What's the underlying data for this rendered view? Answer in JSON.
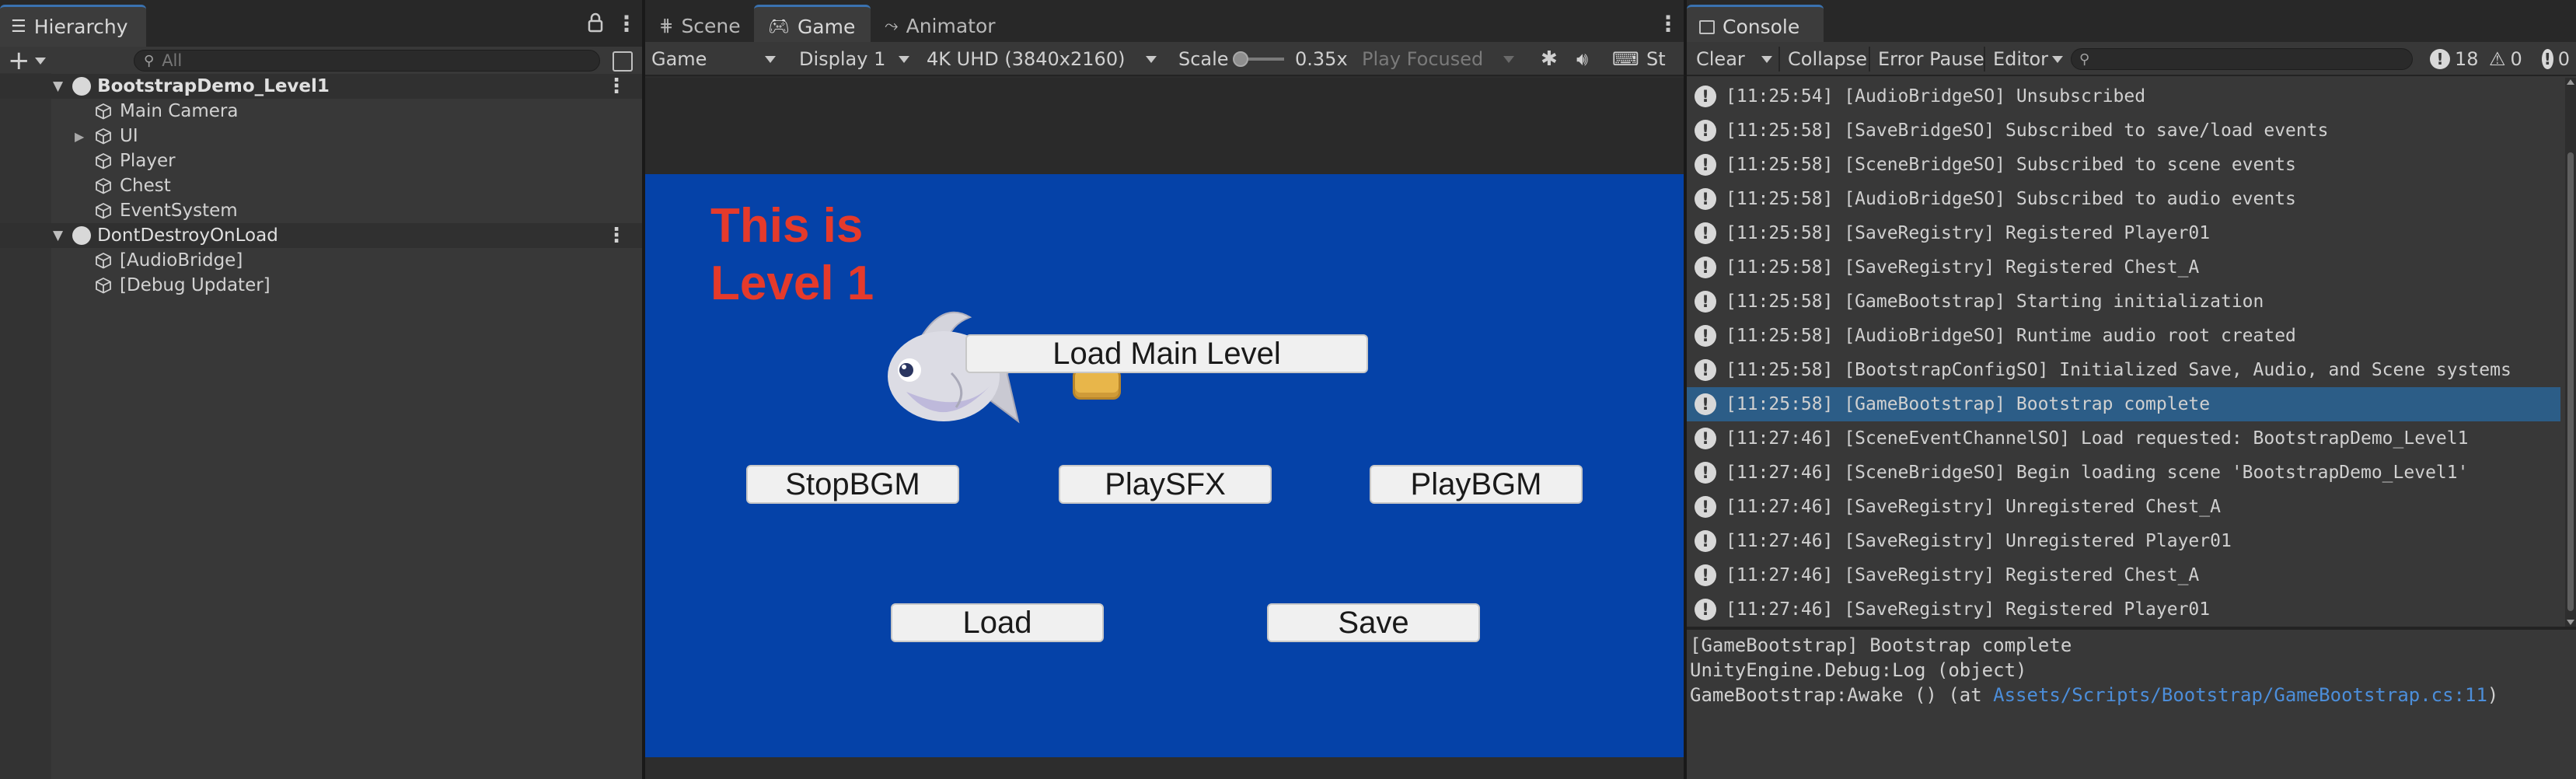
{
  "hierarchy": {
    "tab_label": "Hierarchy",
    "search_placeholder": "All",
    "items": [
      {
        "label": "BootstrapDemo_Level1"
      },
      {
        "label": "Main Camera"
      },
      {
        "label": "UI"
      },
      {
        "label": "Player"
      },
      {
        "label": "Chest"
      },
      {
        "label": "EventSystem"
      },
      {
        "label": "DontDestroyOnLoad"
      },
      {
        "label": "[AudioBridge]"
      },
      {
        "label": "[Debug Updater]"
      }
    ]
  },
  "center": {
    "tabs": [
      {
        "label": "Scene"
      },
      {
        "label": "Game"
      },
      {
        "label": "Animator"
      }
    ],
    "toolbar": {
      "view_mode": "Game",
      "display": "Display 1",
      "resolution": "4K UHD (3840x2160)",
      "scale_label": "Scale",
      "scale_value": "0.35x",
      "play_mode": "Play Focused",
      "stats_label": "St"
    },
    "scale_level": 0.03
  },
  "game": {
    "title_line1": "This is",
    "title_line2": "Level 1",
    "buttons": {
      "load_main_level": "Load Main Level",
      "stop_bgm": "StopBGM",
      "play_sfx": "PlaySFX",
      "play_bgm": "PlayBGM",
      "load": "Load",
      "save": "Save"
    },
    "colors": {
      "background": "#0542A8",
      "title": "#E53A2B",
      "coin": "#E8B64A"
    }
  },
  "console": {
    "tab_label": "Console",
    "toolbar": {
      "clear": "Clear",
      "collapse": "Collapse",
      "error_pause": "Error Pause",
      "editor": "Editor",
      "log_count": "18",
      "warn_count": "0",
      "error_count": "0"
    },
    "entries": [
      "[11:25:54] [AudioBridgeSO] Unsubscribed",
      "[11:25:58] [SaveBridgeSO] Subscribed to save/load events",
      "[11:25:58] [SceneBridgeSO] Subscribed to scene events",
      "[11:25:58] [AudioBridgeSO] Subscribed to audio events",
      "[11:25:58] [SaveRegistry] Registered Player01",
      "[11:25:58] [SaveRegistry] Registered Chest_A",
      "[11:25:58] [GameBootstrap] Starting initialization",
      "[11:25:58] [AudioBridgeSO] Runtime audio root created",
      "[11:25:58] [BootstrapConfigSO] Initialized Save, Audio, and Scene systems",
      "[11:25:58] [GameBootstrap] Bootstrap complete",
      "[11:27:46] [SceneEventChannelSO] Load requested: BootstrapDemo_Level1",
      "[11:27:46] [SceneBridgeSO] Begin loading scene 'BootstrapDemo_Level1'",
      "[11:27:46] [SaveRegistry] Unregistered Chest_A",
      "[11:27:46] [SaveRegistry] Unregistered Player01",
      "[11:27:46] [SaveRegistry] Registered Chest_A",
      "[11:27:46] [SaveRegistry] Registered Player01"
    ],
    "selected_index": 9,
    "detail": {
      "line1": "[GameBootstrap] Bootstrap complete",
      "line2": "UnityEngine.Debug:Log (object)",
      "line3_prefix": "GameBootstrap:Awake () (at ",
      "line3_link": "Assets/Scripts/Bootstrap/GameBootstrap.cs:11",
      "line3_suffix": ")"
    },
    "colors": {
      "selected": "#2C5D87",
      "link": "#4C8EDA"
    }
  }
}
